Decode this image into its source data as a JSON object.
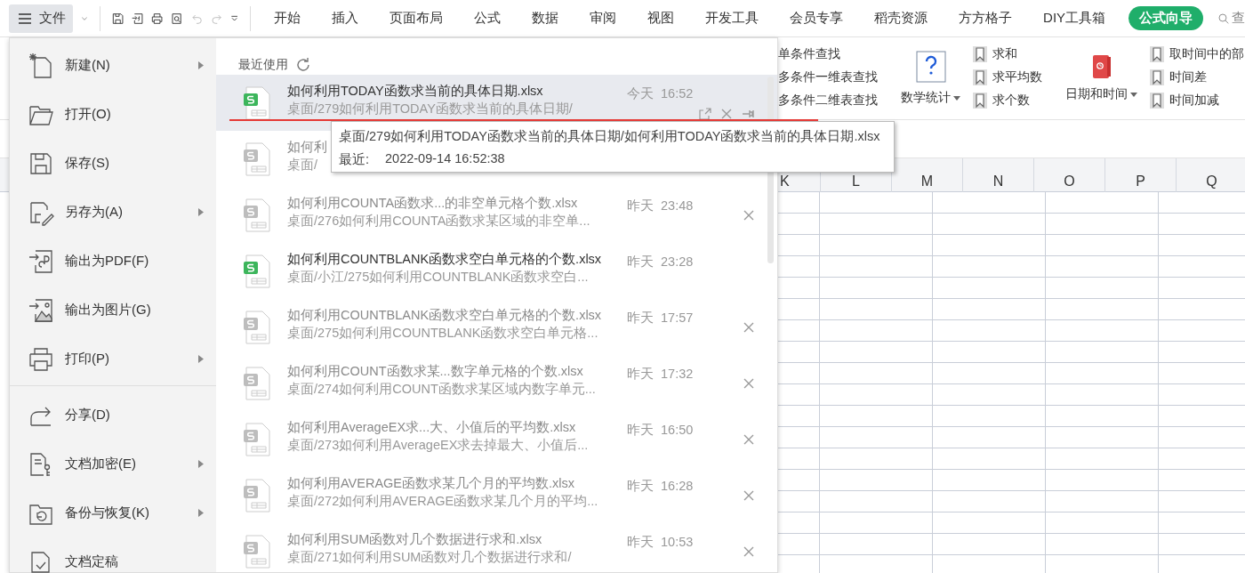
{
  "toolbar": {
    "file_button": "文件",
    "tabs": [
      {
        "label": "开始",
        "selected": false
      },
      {
        "label": "插入",
        "selected": false
      },
      {
        "label": "页面布局",
        "selected": false
      },
      {
        "label": "公式",
        "selected": false
      },
      {
        "label": "数据",
        "selected": false
      },
      {
        "label": "审阅",
        "selected": false
      },
      {
        "label": "视图",
        "selected": false
      },
      {
        "label": "开发工具",
        "selected": false
      },
      {
        "label": "会员专享",
        "selected": false
      },
      {
        "label": "稻壳资源",
        "selected": false
      },
      {
        "label": "方方格子",
        "selected": false
      },
      {
        "label": "DIY工具箱",
        "selected": false
      },
      {
        "label": "公式向导",
        "selected": true
      }
    ],
    "search": "查"
  },
  "ribbon": {
    "lookup_items": [
      "单条件查找",
      "多条件一维表查找",
      "多条件二维表查找"
    ],
    "math_button": "数学统计",
    "math_items": [
      "求和",
      "求平均数",
      "求个数"
    ],
    "date_button": "日期和时间",
    "date_items": [
      "取时间中的部",
      "时间差",
      "时间加减"
    ]
  },
  "sheet": {
    "columns": [
      "K",
      "L",
      "M",
      "N",
      "O",
      "P",
      "Q"
    ]
  },
  "file_menu": {
    "groups": [
      [
        {
          "label": "新建(N)",
          "kind": "new",
          "submenu": true
        },
        {
          "label": "打开(O)",
          "kind": "open",
          "submenu": false
        },
        {
          "label": "保存(S)",
          "kind": "save",
          "submenu": false
        },
        {
          "label": "另存为(A)",
          "kind": "saveas",
          "submenu": true
        },
        {
          "label": "输出为PDF(F)",
          "kind": "pdf",
          "submenu": false
        },
        {
          "label": "输出为图片(G)",
          "kind": "image",
          "submenu": false
        },
        {
          "label": "打印(P)",
          "kind": "print",
          "submenu": true
        }
      ],
      [
        {
          "label": "分享(D)",
          "kind": "share",
          "submenu": false
        },
        {
          "label": "文档加密(E)",
          "kind": "encrypt",
          "submenu": true
        },
        {
          "label": "备份与恢复(K)",
          "kind": "backup",
          "submenu": true
        },
        {
          "label": "文档定稿",
          "kind": "final",
          "submenu": false
        }
      ]
    ],
    "recent": {
      "heading": "最近使用",
      "files": [
        {
          "title": "如何利用TODAY函数求当前的具体日期.xlsx",
          "path": "桌面/279如何利用TODAY函数求当前的具体日期/",
          "time": "今天  16:52",
          "current": true,
          "selected": true,
          "closable": true
        },
        {
          "title": "如何利",
          "path": "桌面/",
          "current": false,
          "selected": false,
          "closable": false
        },
        {
          "title": "如何利用COUNTA函数求...的非空单元格个数.xlsx",
          "path": "桌面/276如何利用COUNTA函数求某区域的非空单...",
          "time": "昨天  23:48",
          "current": false,
          "selected": false,
          "closable": true
        },
        {
          "title": "如何利用COUNTBLANK函数求空白单元格的个数.xlsx",
          "path": "桌面/小江/275如何利用COUNTBLANK函数求空白...",
          "time": "昨天  23:28",
          "current": true,
          "selected": false,
          "closable": false
        },
        {
          "title": "如何利用COUNTBLANK函数求空白单元格的个数.xlsx",
          "path": "桌面/275如何利用COUNTBLANK函数求空白单元格...",
          "time": "昨天  17:57",
          "current": false,
          "selected": false,
          "closable": true
        },
        {
          "title": "如何利用COUNT函数求某...数字单元格的个数.xlsx",
          "path": "桌面/274如何利用COUNT函数求某区域内数字单元...",
          "time": "昨天  17:32",
          "current": false,
          "selected": false,
          "closable": true
        },
        {
          "title": "如何利用AverageEX求...大、小值后的平均数.xlsx",
          "path": "桌面/273如何利用AverageEX求去掉最大、小值后...",
          "time": "昨天  16:50",
          "current": false,
          "selected": false,
          "closable": true
        },
        {
          "title": "如何利用AVERAGE函数求某几个月的平均数.xlsx",
          "path": "桌面/272如何利用AVERAGE函数求某几个月的平均...",
          "time": "昨天  16:28",
          "current": false,
          "selected": false,
          "closable": true
        },
        {
          "title": "如何利用SUM函数对几个数据进行求和.xlsx",
          "path": "桌面/271如何利用SUM函数对几个数据进行求和/",
          "time": "昨天  10:53",
          "current": false,
          "selected": false,
          "closable": true
        }
      ]
    }
  },
  "tooltip": {
    "path": "桌面/279如何利用TODAY函数求当前的具体日期/如何利用TODAY函数求当前的具体日期.xlsx",
    "label": "最近:",
    "time": "2022-09-14 16:52:38"
  }
}
